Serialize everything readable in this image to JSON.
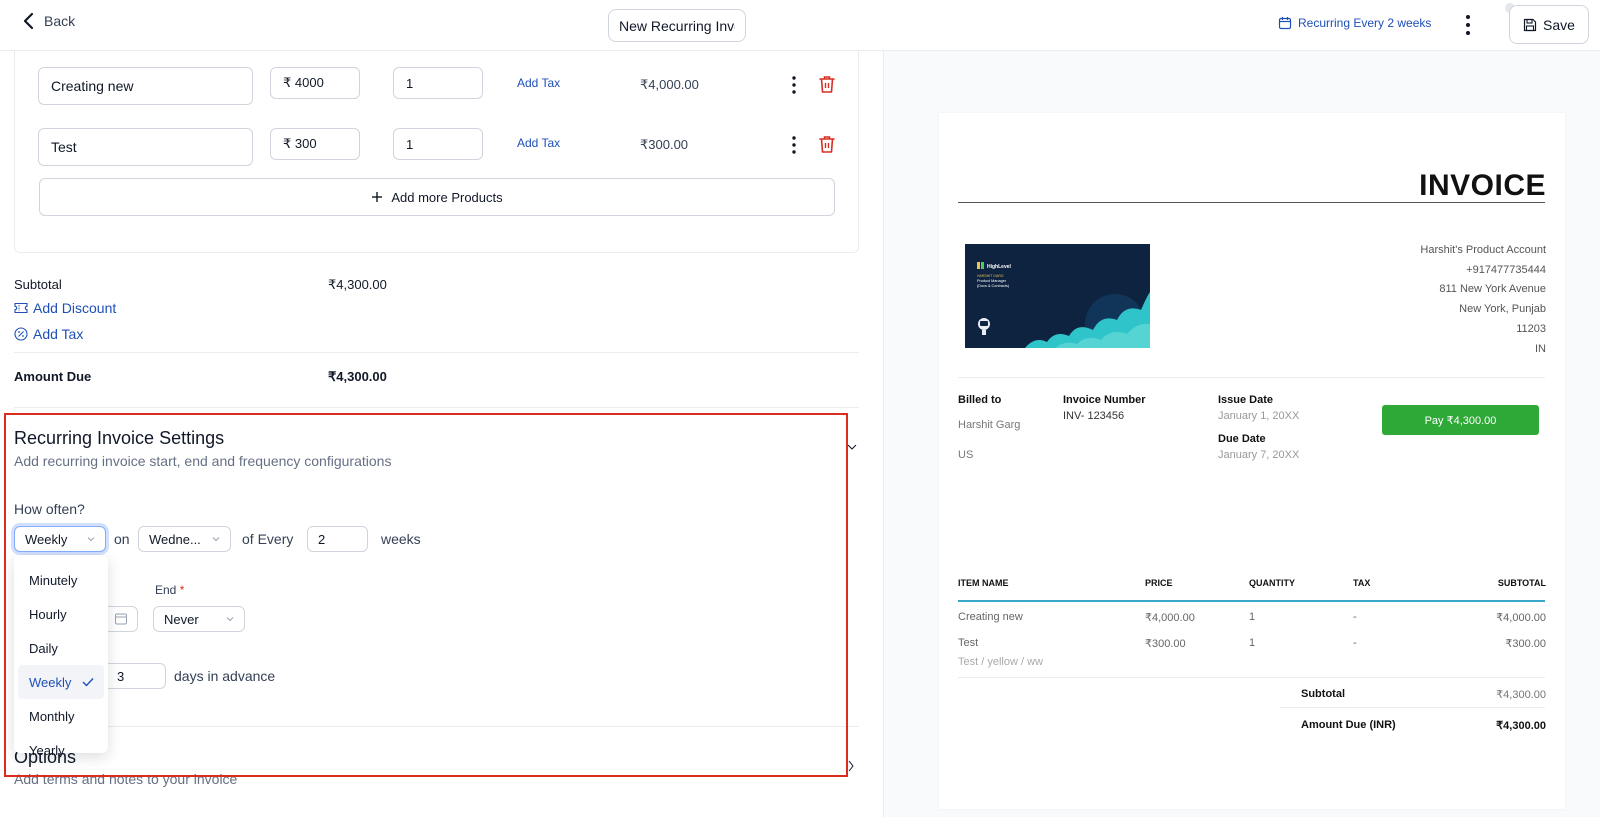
{
  "header": {
    "back_label": "Back",
    "invoice_name": "New Recurring Invoice",
    "recurring_label": "Recurring Every 2 weeks",
    "save_label": "Save"
  },
  "products": [
    {
      "name": "Creating new",
      "price": "₹ 4000",
      "quantity": "1",
      "add_tax_label": "Add Tax",
      "amount": "₹4,000.00"
    },
    {
      "name": "Test",
      "price": "₹ 300",
      "quantity": "1",
      "add_tax_label": "Add Tax",
      "amount": "₹300.00"
    }
  ],
  "add_more_label": "Add more Products",
  "summary": {
    "subtotal_label": "Subtotal",
    "subtotal_value": "₹4,300.00",
    "add_discount_label": "Add Discount",
    "add_tax_label": "Add Tax",
    "amount_due_label": "Amount Due",
    "amount_due_value": "₹4,300.00"
  },
  "recurring": {
    "title": "Recurring Invoice Settings",
    "subtitle": "Add recurring invoice start, end and frequency configurations",
    "how_often_label": "How often?",
    "frequency_value": "Weekly",
    "on_label": "on",
    "day_value": "Wedne...",
    "of_every_label": "of Every",
    "interval_value": "2",
    "unit_label": "weeks",
    "end_label": "End",
    "end_required_mark": "*",
    "end_value": "Never",
    "advance_value": "3",
    "advance_label": "days in advance",
    "frequency_options": [
      "Minutely",
      "Hourly",
      "Daily",
      "Weekly",
      "Monthly",
      "Yearly"
    ],
    "selected_option": "Weekly"
  },
  "options_section": {
    "title": "Options",
    "subtitle": "Add terms and notes to your invoice"
  },
  "invoice_preview": {
    "title": "INVOICE",
    "logo": {
      "brand": "HighLevel",
      "name": "HARSHIT GARG",
      "role": "Product Manager",
      "team": "(Docs & Contracts)"
    },
    "business_address": [
      "Harshit's Product Account",
      "+917477735444",
      "811 New York Avenue",
      "New York, Punjab",
      "11203",
      "IN"
    ],
    "billed_to_label": "Billed to",
    "billed_to_name": "Harshit Garg",
    "billed_to_country": "US",
    "invoice_number_label": "Invoice Number",
    "invoice_number": "INV- 123456",
    "issue_date_label": "Issue Date",
    "issue_date": "January 1, 20XX",
    "due_date_label": "Due Date",
    "due_date": "January 7, 20XX",
    "pay_button": "Pay ₹4,300.00",
    "columns": [
      "ITEM NAME",
      "PRICE",
      "QUANTITY",
      "TAX",
      "SUBTOTAL"
    ],
    "rows": [
      {
        "name": "Creating new",
        "price": "₹4,000.00",
        "quantity": "1",
        "tax": "-",
        "subtotal": "₹4,000.00",
        "variant": ""
      },
      {
        "name": "Test",
        "price": "₹300.00",
        "quantity": "1",
        "tax": "-",
        "subtotal": "₹300.00",
        "variant": "Test / yellow / ww"
      }
    ],
    "subtotal_label": "Subtotal",
    "subtotal_value": "₹4,300.00",
    "amount_due_label": "Amount Due (INR)",
    "amount_due_value": "₹4,300.00"
  },
  "colors": {
    "accent": "#1e4fb8",
    "danger": "#d92d20",
    "pay_green": "#2ea836",
    "table_rule": "#37a8c9"
  }
}
